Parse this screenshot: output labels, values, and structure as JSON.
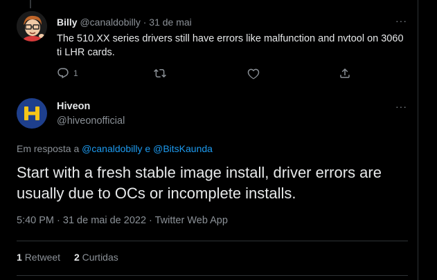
{
  "colors": {
    "background": "#000000",
    "text": "#e7e9ea",
    "muted": "#8b9197",
    "link": "#1d9bf0",
    "divider": "#2f3336",
    "hiveon_brand": "#1e3f8c",
    "hiveon_accent": "#f5c518"
  },
  "prev_tweet": {
    "name": "Billy",
    "handle": "@canaldobilly",
    "separator": "·",
    "date": "31 de mai",
    "text": "The 510.XX series drivers still have errors like malfunction and nvtool on 3060 ti LHR cards.",
    "more_label": "···",
    "reply_count": "1",
    "icons": {
      "reply": "reply-icon",
      "retweet": "retweet-icon",
      "like": "like-icon",
      "share": "share-icon"
    }
  },
  "main_tweet": {
    "name": "Hiveon",
    "handle": "@hiveonofficial",
    "more_label": "···",
    "reply_prefix": "Em resposta a",
    "reply_user_1": "@canaldobilly",
    "reply_conjunction": "e",
    "reply_user_2": "@BitsKaunda",
    "text": "Start with a fresh stable image install, driver errors are usually due to OCs or incomplete installs.",
    "meta": "5:40 PM · 31 de mai de 2022 · Twitter Web App",
    "retweet_count": "1",
    "retweet_label": "Retweet",
    "like_count": "2",
    "like_label": "Curtidas"
  }
}
